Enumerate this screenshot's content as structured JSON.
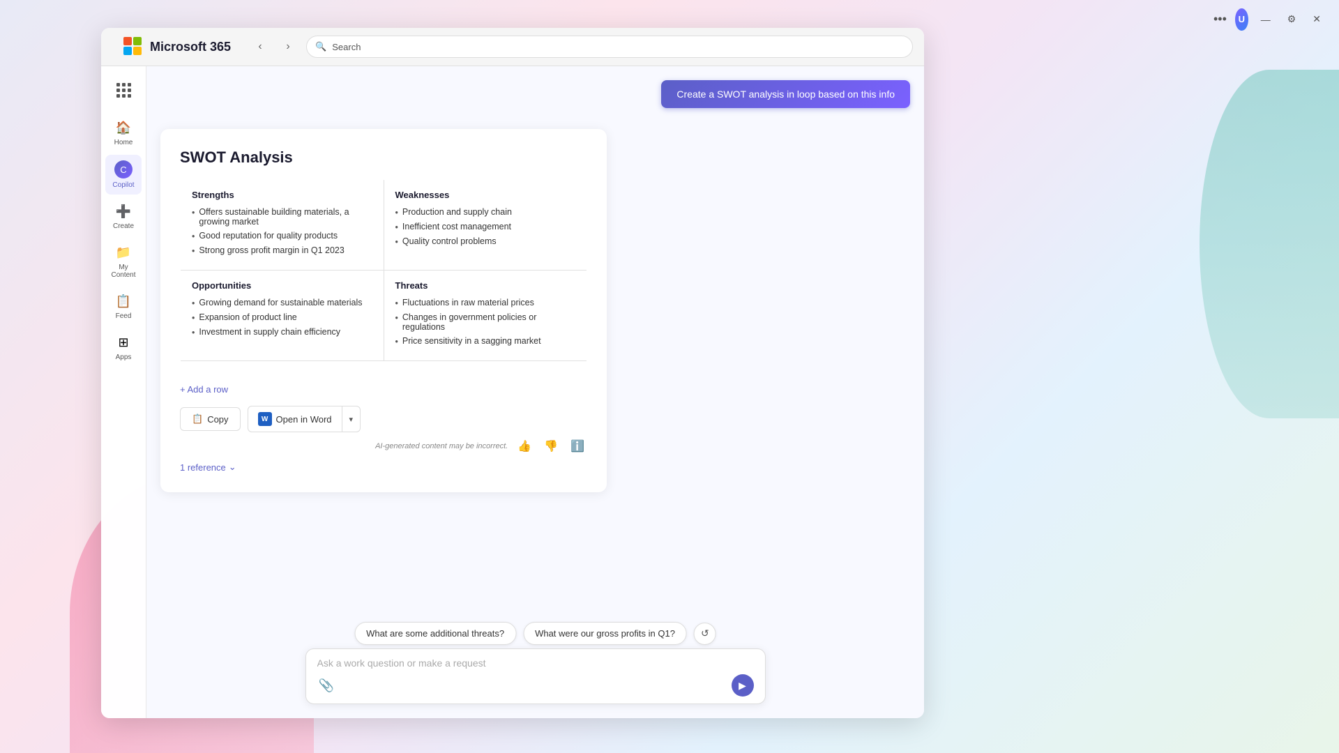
{
  "app": {
    "title": "Microsoft 365"
  },
  "topbar": {
    "dots_label": "•••",
    "avatar_initials": "U",
    "minimize": "—",
    "settings": "⚙",
    "close": "✕"
  },
  "browser": {
    "search_placeholder": "Search",
    "search_value": "Search"
  },
  "sidebar": {
    "apps_tooltip": "Apps",
    "items": [
      {
        "id": "home",
        "label": "Home",
        "icon": "🏠"
      },
      {
        "id": "copilot",
        "label": "Copilot",
        "icon": "C",
        "active": true
      },
      {
        "id": "create",
        "label": "Create",
        "icon": "➕"
      },
      {
        "id": "my-content",
        "label": "My Content",
        "icon": "📁"
      },
      {
        "id": "feed",
        "label": "Feed",
        "icon": "📋"
      },
      {
        "id": "apps",
        "label": "Apps",
        "icon": "⊞"
      }
    ]
  },
  "create_swot_button": "Create a SWOT analysis in loop based on this info",
  "swot": {
    "title": "SWOT Analysis",
    "strengths": {
      "heading": "Strengths",
      "items": [
        "Offers sustainable building materials, a growing market",
        "Good reputation for quality products",
        "Strong gross profit margin in Q1 2023"
      ]
    },
    "weaknesses": {
      "heading": "Weaknesses",
      "items": [
        "Production and supply chain",
        "Inefficient cost management",
        "Quality control problems"
      ]
    },
    "opportunities": {
      "heading": "Opportunities",
      "items": [
        "Growing demand for sustainable materials",
        "Expansion of product line",
        "Investment in supply chain efficiency"
      ]
    },
    "threats": {
      "heading": "Threats",
      "items": [
        "Fluctuations in raw material prices",
        "Changes in government policies or regulations",
        "Price sensitivity in a sagging market"
      ]
    },
    "add_row": "+ Add a row"
  },
  "actions": {
    "copy": "Copy",
    "open_in_word": "Open in Word",
    "dropdown_arrow": "▾"
  },
  "footer": {
    "ai_disclaimer": "AI-generated content may be incorrect.",
    "thumbs_up": "👍",
    "thumbs_down": "👎",
    "info": "ℹ"
  },
  "reference": {
    "label": "1 reference",
    "chevron": "⌄"
  },
  "suggestions": {
    "chips": [
      "What are some additional threats?",
      "What were our gross profits in Q1?"
    ],
    "refresh": "↺"
  },
  "chat_input": {
    "placeholder": "Ask a work question or make a request",
    "attach_icon": "📎",
    "send_icon": "▶"
  }
}
